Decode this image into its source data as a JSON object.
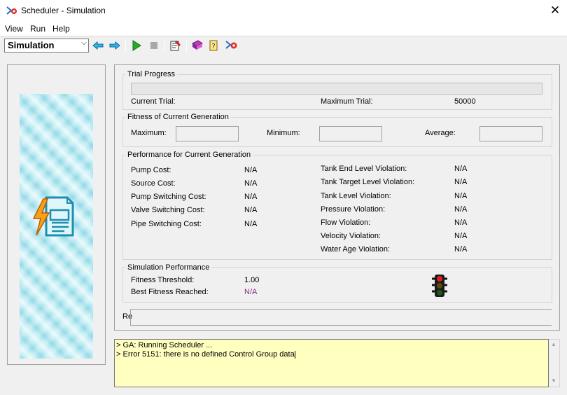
{
  "window": {
    "title": "Scheduler - Simulation",
    "close_glyph": "✕"
  },
  "menu": [
    "View",
    "Run",
    "Help"
  ],
  "toolbar": {
    "mode": "Simulation",
    "mode_chevron": "⌵",
    "icons": [
      "back-arrow-icon",
      "forward-arrow-icon",
      "run-icon",
      "stop-icon",
      "settings-icon",
      "book-icon",
      "help-icon",
      "scheduler-icon"
    ]
  },
  "trial_progress": {
    "title": "Trial Progress",
    "current_trial_label": "Current Trial:",
    "current_trial_value": "",
    "maximum_trial_label": "Maximum Trial:",
    "maximum_trial_value": "50000",
    "progress": 0
  },
  "fitness": {
    "title": "Fitness of Current Generation",
    "maximum_label": "Maximum:",
    "minimum_label": "Minimum:",
    "average_label": "Average:",
    "maximum_value": "",
    "minimum_value": "",
    "average_value": ""
  },
  "performance": {
    "title": "Performance for Current Generation",
    "left": [
      {
        "label": "Pump Cost:",
        "value": "N/A"
      },
      {
        "label": "Source Cost:",
        "value": "N/A"
      },
      {
        "label": "Pump Switching Cost:",
        "value": "N/A"
      },
      {
        "label": "Valve Switching Cost:",
        "value": "N/A"
      },
      {
        "label": "Pipe Switching Cost:",
        "value": "N/A"
      }
    ],
    "right": [
      {
        "label": "Tank End Level Violation:",
        "value": "N/A"
      },
      {
        "label": "Tank Target Level Violation:",
        "value": "N/A"
      },
      {
        "label": "Tank Level Violation:",
        "value": "N/A"
      },
      {
        "label": "Pressure Violation:",
        "value": "N/A"
      },
      {
        "label": "Flow Violation:",
        "value": "N/A"
      },
      {
        "label": "Velocity Violation:",
        "value": "N/A"
      },
      {
        "label": "Water Age Violation:",
        "value": "N/A"
      }
    ]
  },
  "simulation_performance": {
    "title": "Simulation Performance",
    "fitness_threshold_label": "Fitness Threshold:",
    "fitness_threshold_value": "1.00",
    "best_fitness_label": "Best Fitness Reached:",
    "best_fitness_value": "N/A",
    "status_icon": "traffic-light-icon"
  },
  "results": {
    "label": "Re"
  },
  "log": [
    "> GA: Running Scheduler ...",
    "> Error 5151: there is no defined Control Group data"
  ],
  "colors": {
    "log_background": "#ffffc0",
    "highlight_value": "#8b2a8b",
    "banner": "#8fd8e6"
  }
}
